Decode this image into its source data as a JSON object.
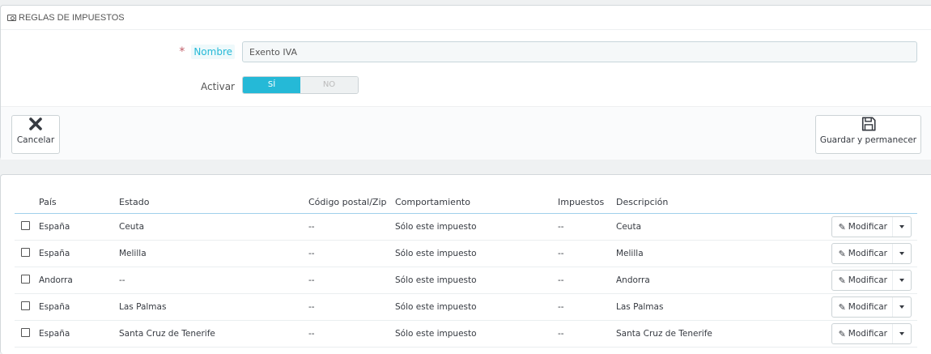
{
  "panel": {
    "title": "REGLAS DE IMPUESTOS",
    "name_required": "*",
    "name_label": "Nombre",
    "name_value": "Exento IVA",
    "active_label": "Activar",
    "switch_on": "SÍ",
    "switch_off": "NO",
    "cancel_label": "Cancelar",
    "save_label": "Guardar y permanecer"
  },
  "table": {
    "headers": [
      "País",
      "Estado",
      "Código postal/Zip",
      "Comportamiento",
      "Impuestos",
      "Descripción"
    ],
    "rows": [
      {
        "country": "España",
        "state": "Ceuta",
        "zip": "--",
        "behavior": "Sólo este impuesto",
        "tax": "--",
        "description": "Ceuta",
        "action": "Modificar"
      },
      {
        "country": "España",
        "state": "Melilla",
        "zip": "--",
        "behavior": "Sólo este impuesto",
        "tax": "--",
        "description": "Melilla",
        "action": "Modificar"
      },
      {
        "country": "Andorra",
        "state": "--",
        "zip": "--",
        "behavior": "Sólo este impuesto",
        "tax": "--",
        "description": "Andorra",
        "action": "Modificar"
      },
      {
        "country": "España",
        "state": "Las Palmas",
        "zip": "--",
        "behavior": "Sólo este impuesto",
        "tax": "--",
        "description": "Las Palmas",
        "action": "Modificar"
      },
      {
        "country": "España",
        "state": "Santa Cruz de Tenerife",
        "zip": "--",
        "behavior": "Sólo este impuesto",
        "tax": "--",
        "description": "Santa Cruz de Tenerife",
        "action": "Modificar"
      }
    ]
  },
  "icons": {
    "heading": "money-icon",
    "cancel": "close-icon",
    "save": "save-icon",
    "edit": "pencil-icon",
    "dropdown": "caret-down-icon"
  },
  "colors": {
    "accent": "#25b9d7",
    "required": "#c05c67"
  }
}
